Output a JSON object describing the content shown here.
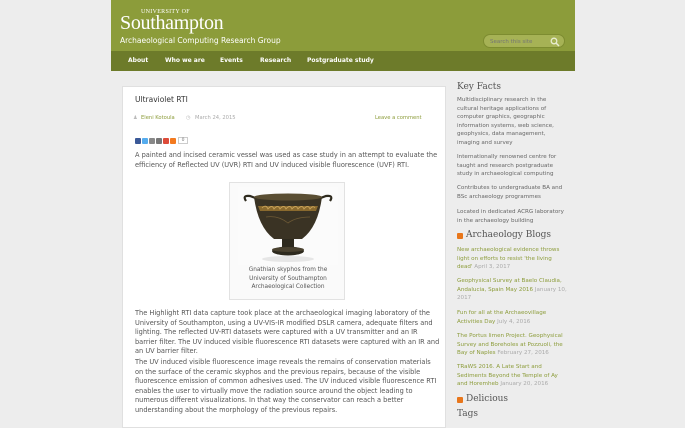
{
  "header": {
    "logo_small": "UNIVERSITY OF",
    "logo_big": "Southampton",
    "tagline": "Archaeological Computing Research Group",
    "search_placeholder": "Search this site"
  },
  "nav": {
    "items": [
      "About",
      "Who we are",
      "Events",
      "Research",
      "Postgraduate study"
    ]
  },
  "post": {
    "title": "Ultraviolet RTI",
    "author": "Eleni Kotoula",
    "date": "March 24, 2015",
    "comment_link": "Leave a comment",
    "share_count": "0",
    "intro": "A painted and incised ceramic vessel was used as case study in an attempt to evaluate the efficiency of Reflected UV (UVR) RTI and UV induced visible fluorescence (UVF) RTI.",
    "figure_caption": "Gnathian skyphos from the University of Southampton Archaeological Collection",
    "para2": "The Highlight RTI data capture took place at the archaeological imaging laboratory of the University of Southampton, using a UV-VIS-IR modified DSLR camera, adequate filters and lighting. The reflected UV-RTI datasets were captured with a UV transmitter and an IR barrier filter. The UV induced visible fluorescence RTI datasets were captured with an IR and an UV barrier filter.",
    "para3": "The UV induced visible fluorescence image reveals the remains of conservation materials on the surface of the ceramic skyphos and the previous repairs, because of the visible fluorescence emission of common adhesives used. The UV induced visible fluorescence RTI enables the user to virtually move the radiation source around the object leading to numerous different visualizations. In that way the conservator can reach a better understanding about the morphology of the previous repairs."
  },
  "sidebar": {
    "key_facts_title": "Key Facts",
    "key_facts": [
      "Multidisciplinary research in the cultural heritage applications of computer graphics, geographic information systems, web science, geophysics, data management, imaging and survey",
      "Internationally renowned centre for taught and research postgraduate study in archaeological computing",
      "Contributes to undergraduate BA and BSc archaeology programmes",
      "Located in dedicated ACRG laboratory in the archaeology building"
    ],
    "blogs_title": "Archaeology Blogs",
    "blogs": [
      {
        "title": "New archaeological evidence throws light on efforts to resist 'the living dead'",
        "date": "April 3, 2017"
      },
      {
        "title": "Geophysical Survey at Baelo Claudia, Andalucia, Spain May 2016",
        "date": "January 10, 2017"
      },
      {
        "title": "Fun for all at the Archaeovillage Activities Day",
        "date": "July 4, 2016"
      },
      {
        "title": "The Portus limen Project. Geophysical Survey and Boreholes at Pozzuoli, the Bay of Naples",
        "date": "February 27, 2016"
      },
      {
        "title": "TRaWS 2016. A Late Start and Sediments Beyond the Temple of Ay and Horemheb",
        "date": "January 20, 2016"
      }
    ],
    "delicious_title": "Delicious",
    "tags_title": "Tags"
  }
}
